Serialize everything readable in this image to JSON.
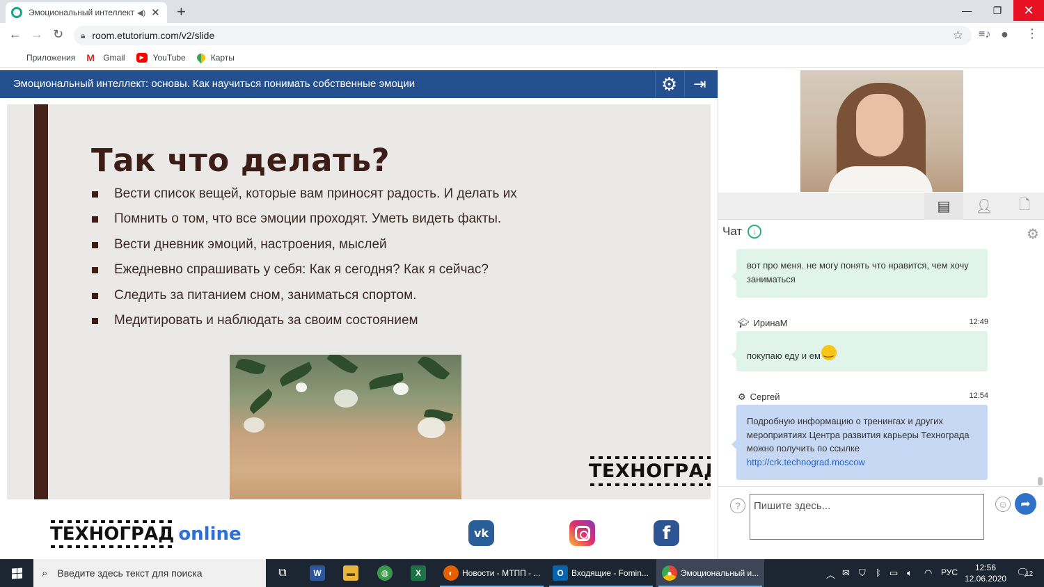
{
  "browser": {
    "tab_title": "Эмоциональный интеллект",
    "url": "room.etutorium.com/v2/slide",
    "bookmarks": [
      "Приложения",
      "Gmail",
      "YouTube",
      "Карты"
    ]
  },
  "app": {
    "header_title": "Эмоциональный интеллект: основы. Как научиться понимать собственные эмоции"
  },
  "slide": {
    "heading": "Так что делать?",
    "items": [
      "Вести список вещей, которые вам приносят радость. И делать их",
      "Помнить о том, что все эмоции проходят. Уметь видеть факты.",
      "Вести дневник эмоций, настроения, мыслей",
      "Ежедневно спрашивать у себя: Как я сегодня? Как я сейчас?",
      "Следить за питанием сном, заниматься спортом.",
      "Медитировать и наблюдать за своим состоянием"
    ],
    "logo": "ТЕХНОГРАД"
  },
  "footer": {
    "brand": "ТЕХНОГРАД",
    "online": "online"
  },
  "chat": {
    "title": "Чат",
    "messages": [
      {
        "author": "",
        "time": "",
        "text": "вот про меня. не могу понять что нравится, чем хочу заниматься"
      },
      {
        "author": "ИринаМ",
        "time": "12:49",
        "text": "покупаю еду и ем"
      },
      {
        "author": "Сергей",
        "time": "12:54",
        "text": "Подробную информацию о тренингах и других мероприятиях Центра развития карьеры Технограда можно получить по ссылке",
        "link": "http://crk.technograd.moscow"
      }
    ],
    "input_placeholder": "Пишите здесь..."
  },
  "taskbar": {
    "search_placeholder": "Введите здесь текст для поиска",
    "apps": [
      {
        "label": "Новости - МТПП - ..."
      },
      {
        "label": "Входящие - Fomin..."
      },
      {
        "label": "Эмоциональный и..."
      }
    ],
    "language": "РУС",
    "time": "12:56",
    "date": "12.06.2020",
    "notifications": "12"
  }
}
